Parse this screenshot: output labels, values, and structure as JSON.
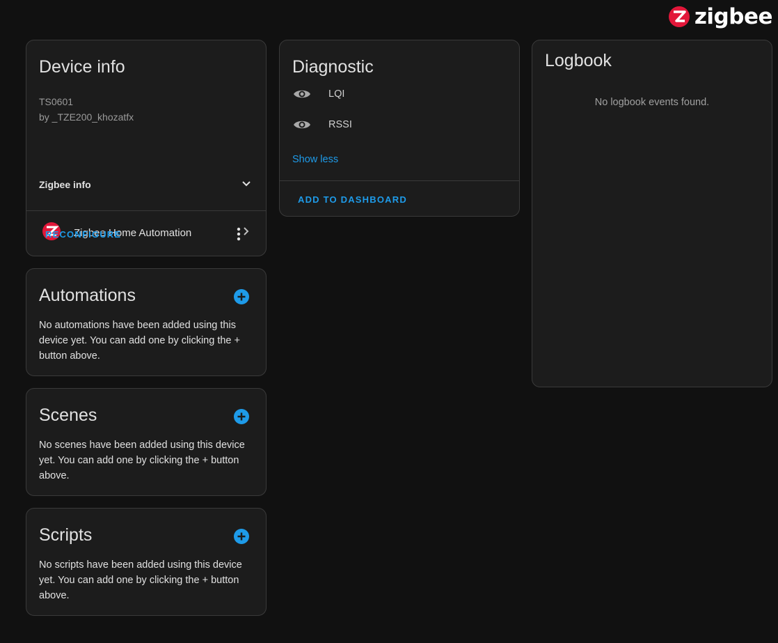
{
  "brand": {
    "name": "zigbee",
    "accent": "#e2173a"
  },
  "device_info": {
    "title": "Device info",
    "model": "TS0601",
    "manufacturer": "by _TZE200_khozatfx",
    "zigbee_info_label": "Zigbee info",
    "integration_label": "Zigbee Home Automation",
    "reconfigure_label": "RECONFIGURE",
    "icons": [
      "chevron-down-icon",
      "chevron-right-icon",
      "more-vertical-icon",
      "zha-logo-icon"
    ]
  },
  "automations": {
    "title": "Automations",
    "description": "No automations have been added using this device yet. You can add one by clicking the + button above."
  },
  "scenes": {
    "title": "Scenes",
    "description": "No scenes have been added using this device yet. You can add one by clicking the + button above."
  },
  "scripts": {
    "title": "Scripts",
    "description": "No scripts have been added using this device yet. You can add one by clicking the + button above."
  },
  "diagnostic": {
    "title": "Diagnostic",
    "entities": [
      {
        "label": "LQI",
        "icon": "eye-icon"
      },
      {
        "label": "RSSI",
        "icon": "eye-icon"
      }
    ],
    "show_less_label": "Show less",
    "add_to_dashboard_label": "ADD TO DASHBOARD"
  },
  "logbook": {
    "title": "Logbook",
    "empty_message": "No logbook events found."
  },
  "colors": {
    "background": "#111111",
    "card": "#1c1c1c",
    "primary": "#1e9be9",
    "text": "#e1e1e1"
  }
}
